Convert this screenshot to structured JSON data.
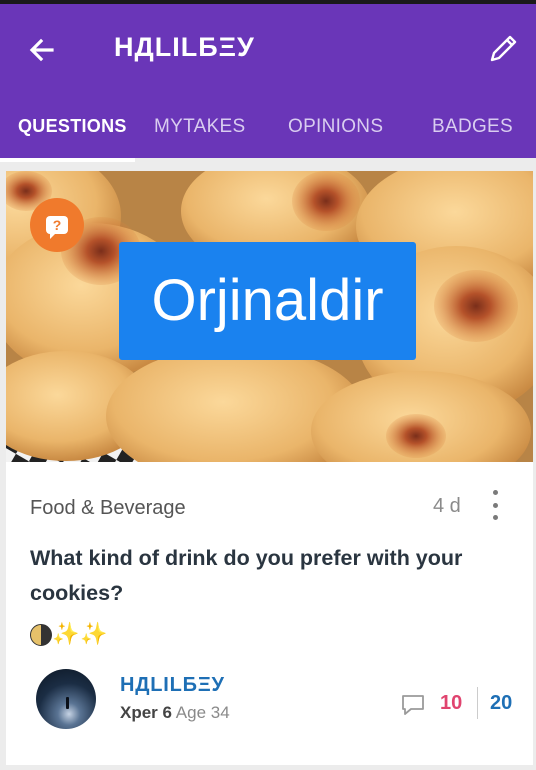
{
  "header": {
    "title": "НДLILБΞУ"
  },
  "tabs": [
    {
      "label": "QUESTIONS",
      "active": true
    },
    {
      "label": "MYTAKES",
      "active": false
    },
    {
      "label": "OPINIONS",
      "active": false
    },
    {
      "label": "BADGES",
      "active": false
    }
  ],
  "card": {
    "image_caption": "Orjinaldir",
    "badge_icon": "question-bubble-icon",
    "category": "Food & Beverage",
    "posted_ago": "4 d",
    "question": "What kind of drink do you prefer with your cookies?",
    "emoji_line": "🌖✨✨",
    "author": {
      "name": "НДLILБΞУ",
      "level": "Xper 6",
      "age": "Age 34"
    },
    "stats": {
      "opinions_count": "10",
      "mytakes_count": "20"
    }
  },
  "colors": {
    "appbar": "#6a36b8",
    "caption_bg": "#1a82ef",
    "badge": "#f07a2c",
    "opinions": "#e0446f",
    "link": "#1e6fb5"
  }
}
